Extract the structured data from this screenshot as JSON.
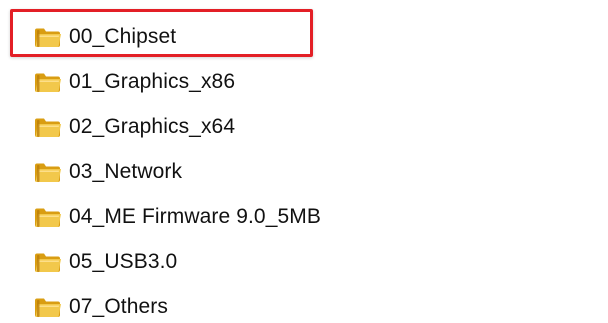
{
  "explorer": {
    "items": [
      {
        "label": "00_Chipset",
        "icon": "folder-icon",
        "highlighted": true
      },
      {
        "label": "01_Graphics_x86",
        "icon": "folder-icon"
      },
      {
        "label": "02_Graphics_x64",
        "icon": "folder-icon"
      },
      {
        "label": "03_Network",
        "icon": "folder-icon"
      },
      {
        "label": "04_ME Firmware 9.0_5MB",
        "icon": "folder-icon"
      },
      {
        "label": "05_USB3.0",
        "icon": "folder-icon"
      },
      {
        "label": "07_Others",
        "icon": "folder-icon"
      }
    ],
    "highlight_color": "#e31f26",
    "folder_color": "#e7b72f"
  }
}
